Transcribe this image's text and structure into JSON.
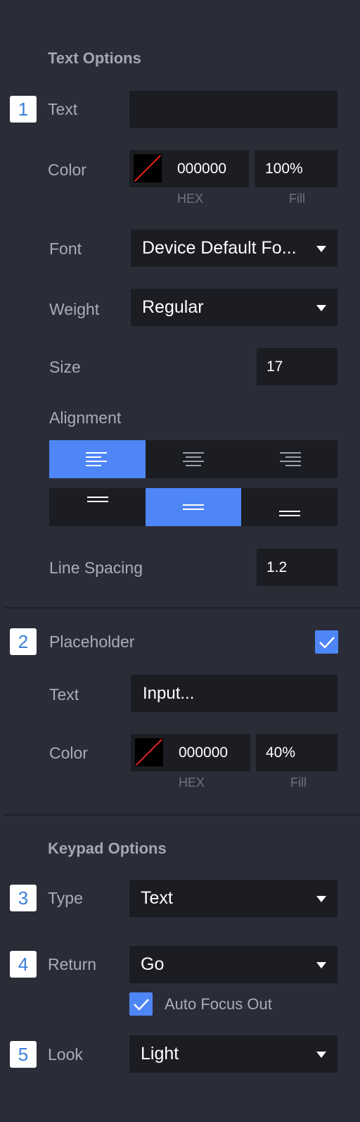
{
  "text_options": {
    "title": "Text Options",
    "badge": "1",
    "text_label": "Text",
    "text_value": "",
    "color_label": "Color",
    "color_hex": "000000",
    "color_fill": "100%",
    "hex_caption": "HEX",
    "fill_caption": "Fill",
    "font_label": "Font",
    "font_value": "Device Default Fo...",
    "weight_label": "Weight",
    "weight_value": "Regular",
    "size_label": "Size",
    "size_value": "17",
    "alignment_label": "Alignment",
    "horizontal_align_options": [
      "left",
      "center",
      "right"
    ],
    "horizontal_align_selected": "left",
    "vertical_align_options": [
      "top",
      "middle",
      "bottom"
    ],
    "vertical_align_selected": "middle",
    "line_spacing_label": "Line Spacing",
    "line_spacing_value": "1.2"
  },
  "placeholder": {
    "badge": "2",
    "label": "Placeholder",
    "enabled": true,
    "text_label": "Text",
    "text_value": "Input...",
    "color_label": "Color",
    "color_hex": "000000",
    "color_fill": "40%",
    "hex_caption": "HEX",
    "fill_caption": "Fill"
  },
  "keypad_options": {
    "title": "Keypad Options",
    "type_badge": "3",
    "type_label": "Type",
    "type_value": "Text",
    "return_badge": "4",
    "return_label": "Return",
    "return_value": "Go",
    "auto_focus_label": "Auto Focus Out",
    "auto_focus_checked": true,
    "look_badge": "5",
    "look_label": "Look",
    "look_value": "Light"
  },
  "colors": {
    "panel_bg": "#2a2d38",
    "field_bg": "#1b1d22",
    "accent": "#4e86f8",
    "badge_text": "#3a7fd8"
  }
}
